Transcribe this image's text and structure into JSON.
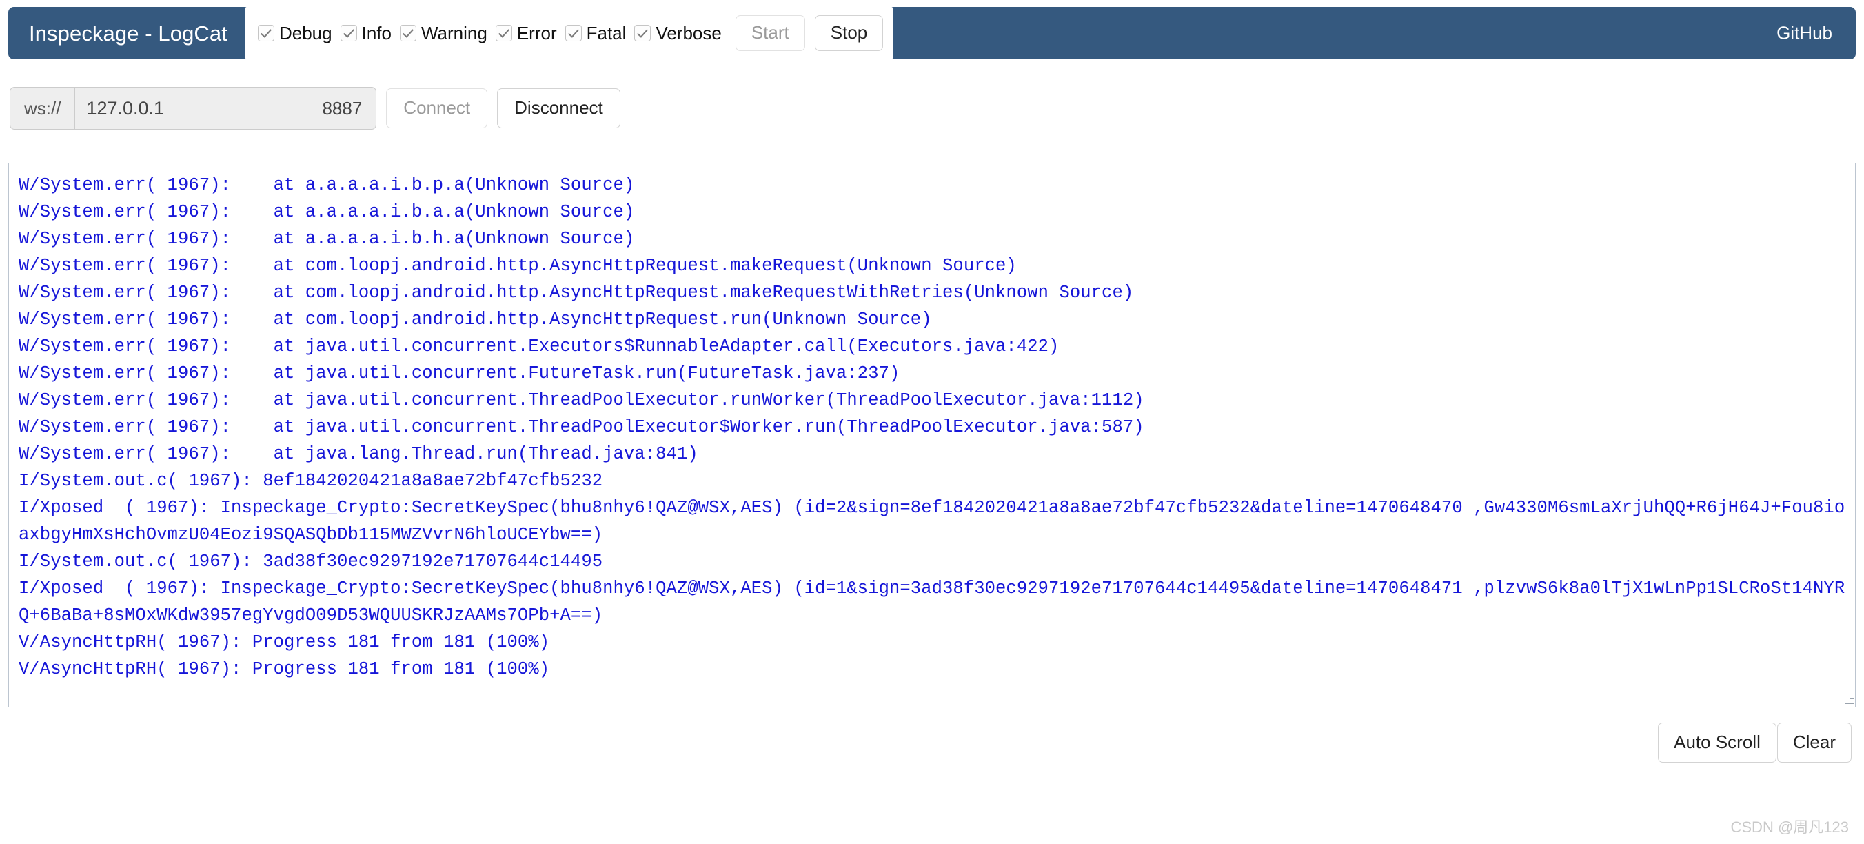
{
  "navbar": {
    "brand": "Inspeckage - LogCat",
    "brand_bg": "#35597f",
    "github_label": "GitHub",
    "filters": [
      {
        "label": "Debug",
        "checked": true
      },
      {
        "label": "Info",
        "checked": true
      },
      {
        "label": "Warning",
        "checked": true
      },
      {
        "label": "Error",
        "checked": true
      },
      {
        "label": "Fatal",
        "checked": true
      },
      {
        "label": "Verbose",
        "checked": true
      }
    ],
    "start_label": "Start",
    "start_disabled": true,
    "stop_label": "Stop",
    "stop_disabled": false
  },
  "connection": {
    "scheme_label": "ws://",
    "host_value": "127.0.0.1",
    "host_placeholder": "127.0.0.1",
    "port_label": "8887",
    "connect_label": "Connect",
    "connect_disabled": true,
    "disconnect_label": "Disconnect",
    "disconnect_disabled": false
  },
  "log": {
    "text_color": "#1616d8",
    "lines": [
      "W/System.err( 1967):    at a.a.a.a.i.b.p.a(Unknown Source)",
      "W/System.err( 1967):    at a.a.a.a.i.b.a.a(Unknown Source)",
      "W/System.err( 1967):    at a.a.a.a.i.b.h.a(Unknown Source)",
      "W/System.err( 1967):    at com.loopj.android.http.AsyncHttpRequest.makeRequest(Unknown Source)",
      "W/System.err( 1967):    at com.loopj.android.http.AsyncHttpRequest.makeRequestWithRetries(Unknown Source)",
      "W/System.err( 1967):    at com.loopj.android.http.AsyncHttpRequest.run(Unknown Source)",
      "W/System.err( 1967):    at java.util.concurrent.Executors$RunnableAdapter.call(Executors.java:422)",
      "W/System.err( 1967):    at java.util.concurrent.FutureTask.run(FutureTask.java:237)",
      "W/System.err( 1967):    at java.util.concurrent.ThreadPoolExecutor.runWorker(ThreadPoolExecutor.java:1112)",
      "W/System.err( 1967):    at java.util.concurrent.ThreadPoolExecutor$Worker.run(ThreadPoolExecutor.java:587)",
      "W/System.err( 1967):    at java.lang.Thread.run(Thread.java:841)",
      "I/System.out.c( 1967): 8ef1842020421a8a8ae72bf47cfb5232",
      "I/Xposed  ( 1967): Inspeckage_Crypto:SecretKeySpec(bhu8nhy6!QAZ@WSX,AES) (id=2&sign=8ef1842020421a8a8ae72bf47cfb5232&dateline=1470648470 ,Gw4330M6smLaXrjUhQQ+R6jH64J+Fou8ioaxbgyHmXsHchOvmzU04Eozi9SQASQbDb115MWZVvrN6hloUCEYbw==)",
      "I/System.out.c( 1967): 3ad38f30ec9297192e71707644c14495",
      "I/Xposed  ( 1967): Inspeckage_Crypto:SecretKeySpec(bhu8nhy6!QAZ@WSX,AES) (id=1&sign=3ad38f30ec9297192e71707644c14495&dateline=1470648471 ,plzvwS6k8a0lTjX1wLnPp1SLCRoSt14NYRQ+6BaBa+8sMOxWKdw3957egYvgdO09D53WQUUSKRJzAAMs7OPb+A==)",
      "V/AsyncHttpRH( 1967): Progress 181 from 181 (100%)",
      "V/AsyncHttpRH( 1967): Progress 181 from 181 (100%)"
    ]
  },
  "bottom": {
    "auto_scroll_label": "Auto Scroll",
    "clear_label": "Clear"
  },
  "watermark": "CSDN @周凡123"
}
